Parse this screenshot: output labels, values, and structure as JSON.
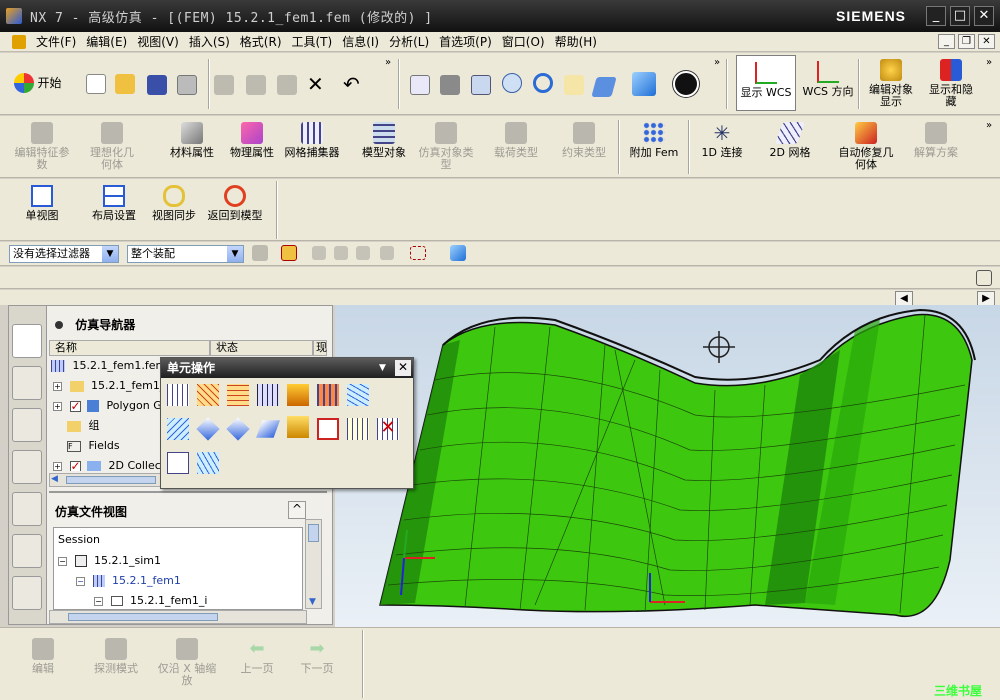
{
  "window": {
    "title": "NX 7 - 高级仿真 - [(FEM) 15.2.1_fem1.fem  (修改的) ]",
    "brand": "SIEMENS"
  },
  "menu": [
    "文件(F)",
    "编辑(E)",
    "视图(V)",
    "插入(S)",
    "格式(R)",
    "工具(T)",
    "信息(I)",
    "分析(L)",
    "首选项(P)",
    "窗口(O)",
    "帮助(H)"
  ],
  "toolbar1": {
    "start": "开始",
    "show_wcs": "显示 WCS",
    "wcs_dir": "WCS 方向",
    "edit_display": "编辑对象显示",
    "show_hide": "显示和隐藏"
  },
  "toolbar2": {
    "edit_feature_params": "编辑特征参数",
    "idealize_geometry": "理想化几何体",
    "material_props": "材料属性",
    "physical_props": "物理属性",
    "mesh_capture": "网格捕集器",
    "model_object": "模型对象",
    "sim_object_type": "仿真对象类型",
    "load_type": "载荷类型",
    "constraint_type": "约束类型",
    "attach_fem": "附加 Fem",
    "connect_1d": "1D 连接",
    "mesh_2d": "2D 网格",
    "auto_repair": "自动修复几何体",
    "solution": "解算方案"
  },
  "toolbar3": {
    "single_view": "单视图",
    "layout_settings": "布局设置",
    "view_sync": "视图同步",
    "return_model": "返回到模型"
  },
  "filters": {
    "selection_filter": "没有选择过滤器",
    "scope": "整个装配"
  },
  "navigator": {
    "title": "仿真导航器",
    "col_name": "名称",
    "col_status": "状态",
    "col_extra": "现",
    "rows": [
      "15.2.1_fem1.fem",
      "15.2.1_fem1_",
      "Polygon Ge",
      "组",
      "Fields",
      "2D Collec"
    ],
    "file_view_title": "仿真文件视图",
    "session": "Session",
    "files": [
      "15.2.1_sim1",
      "15.2.1_fem1",
      "15.2.1_fem1_i"
    ]
  },
  "palette": {
    "title": "单元操作"
  },
  "bottom": {
    "edit": "编辑",
    "probe": "探测模式",
    "x_zoom": "仅沿 X 轴缩放",
    "prev": "上一页",
    "next": "下一页"
  },
  "watermark": "三维书屋",
  "colors": {
    "mesh_green": "#3ec70f",
    "mesh_dark": "#1f8a0a",
    "titlebar": "#1a1a1a"
  }
}
